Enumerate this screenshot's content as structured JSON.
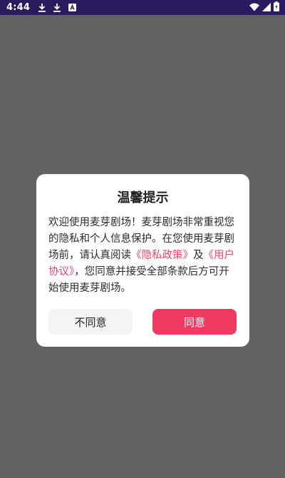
{
  "status_bar": {
    "time": "4:44",
    "left_icons": [
      "download-icon",
      "download-icon",
      "app-notification-icon"
    ],
    "right_icons": [
      "wifi-icon",
      "signal-icon",
      "battery-icon"
    ],
    "background": "#2a1a5e"
  },
  "dialog": {
    "title": "温馨提示",
    "body": {
      "text_before": "欢迎使用麦芽剧场！麦芽剧场非常重视您的隐私和个人信息保护。在您使用麦芽剧场前，请认真阅读",
      "privacy_link": "《隐私政策》",
      "conjunction": "及",
      "agreement_link": "《用户协议》",
      "text_after": "，您同意并接受全部条款后方可开始使用麦芽剧场。"
    },
    "disagree_label": "不同意",
    "agree_label": "同意"
  },
  "colors": {
    "overlay": "#636363",
    "accent": "#f03a62",
    "link": "#f0446a"
  }
}
